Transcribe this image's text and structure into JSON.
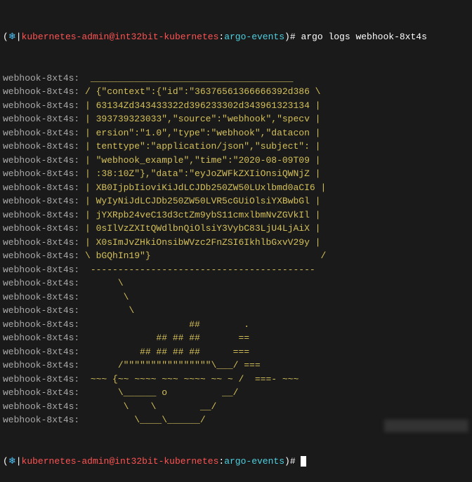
{
  "prompt": {
    "open_paren": "(",
    "icon": "❄",
    "sep": "|",
    "user_host": "kubernetes-admin@int32bit-kubernetes",
    "colon": ":",
    "namespace": "argo-events",
    "close": ")#",
    "command": " argo logs webhook-8xt4s"
  },
  "log_prefix": "webhook-8xt4s:",
  "lines": [
    "  _____________________________________   ",
    " / {\"context\":{\"id\":\"36376561366666392d386 \\ ",
    " | 63134Zd343433322d396233302d343961323134 | ",
    " | 393739323033\",\"source\":\"webhook\",\"specv | ",
    " | ersion\":\"1.0\",\"type\":\"webhook\",\"datacon | ",
    " | tenttype\":\"application/json\",\"subject\": | ",
    " | \"webhook_example\",\"time\":\"2020-08-09T09 | ",
    " | :38:10Z\"},\"data\":\"eyJoZWFkZXIiOnsiQWNjZ | ",
    " | XB0IjpbIioviKiJdLCJDb250ZW50LUxlbmd0aCI6 | ",
    " | WyIyNiJdLCJDb250ZW50LVR5cGUiOlsiYXBwbGl | ",
    " | jYXRpb24veC13d3ctZm9ybS11cmxlbmNvZGVkIl | ",
    " | 0sIlVzZXItQWdlbnQiOlsiY3VybC83LjU4LjAiX | ",
    " | X0sImJvZHkiOnsibWVzc2FnZSI6IkhlbGxvV29y | ",
    " \\ bGQhIn19\"}                               / ",
    "  -----------------------------------------  ",
    "       \\",
    "        \\",
    "         \\",
    "                    ##        .         ",
    "              ## ## ##       ==         ",
    "           ## ## ## ##      ===         ",
    "       /\"\"\"\"\"\"\"\"\"\"\"\"\"\"\"\"\\___/ ===       ",
    "  ~~~ {~~ ~~~~ ~~~ ~~~~ ~~ ~ /  ===- ~~~",
    "       \\______ o          __/           ",
    "        \\    \\        __/               ",
    "          \\____\\______/                 "
  ],
  "prompt2": {
    "command": " "
  }
}
